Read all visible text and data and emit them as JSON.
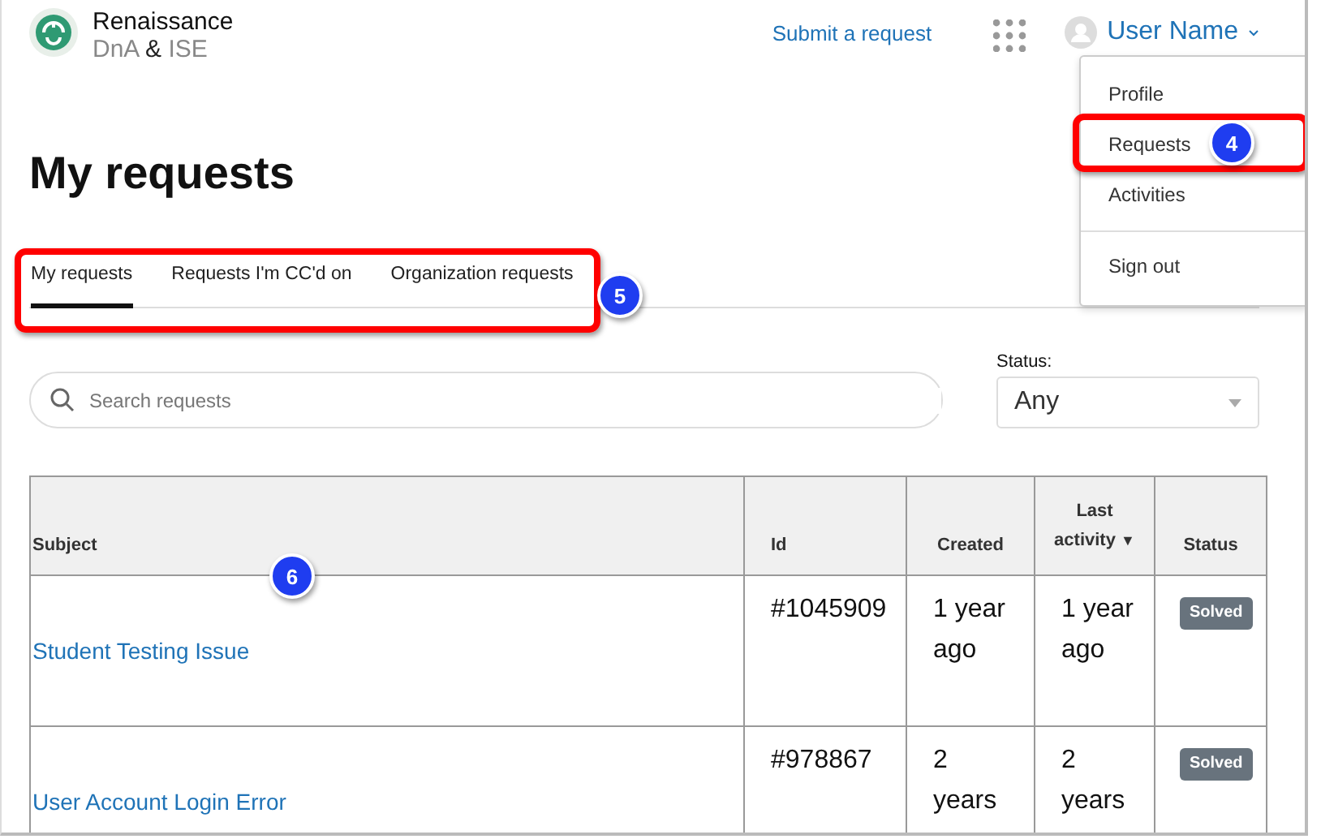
{
  "header": {
    "logo_lines": [
      "Renaissance",
      "DnA **&** ISE"
    ],
    "submit_link": "Submit a request",
    "user_name": "User Name"
  },
  "user_menu": {
    "sections": [
      {
        "items": [
          {
            "label": "Profile"
          },
          {
            "label": "Requests"
          },
          {
            "label": "Activities"
          }
        ]
      },
      {
        "items": [
          {
            "label": "Sign out"
          }
        ]
      }
    ]
  },
  "page_title": "My requests",
  "tabs": [
    {
      "label": "My requests",
      "selected": true
    },
    {
      "label": "Requests I'm CC'd on",
      "selected": false
    },
    {
      "label": "Organization requests",
      "selected": false
    }
  ],
  "search": {
    "placeholder": "Search requests"
  },
  "status_filter": {
    "label": "Status:",
    "value": "Any"
  },
  "table": {
    "columns": [
      {
        "label": "Subject"
      },
      {
        "label": "Id"
      },
      {
        "label": "Created"
      },
      {
        "label": "Last activity",
        "sort_mark": "▼"
      },
      {
        "label": "Status"
      }
    ],
    "rows": [
      {
        "subject": "Student Testing Issue",
        "id": "#1045909",
        "created": "1 year ago",
        "last_activity": "1 year ago",
        "status": "Solved"
      },
      {
        "subject": "User Account Login Error",
        "id": "#978867",
        "created": "2 years",
        "last_activity": "2 years",
        "status": "Solved"
      }
    ]
  },
  "callouts": [
    {
      "number": "4"
    },
    {
      "number": "5"
    },
    {
      "number": "6"
    }
  ]
}
